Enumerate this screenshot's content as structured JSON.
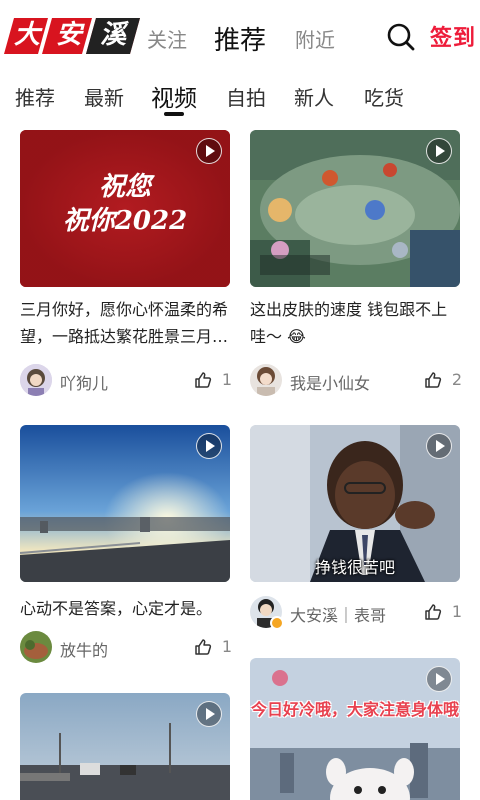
{
  "header": {
    "logo_chars": [
      "大",
      "安",
      "溪"
    ],
    "nav_follow": "关注",
    "nav_recommend": "推荐",
    "nav_nearby": "附近",
    "checkin_label": "签到"
  },
  "tabs": [
    "推荐",
    "最新",
    "视频",
    "自拍",
    "新人",
    "吃货"
  ],
  "active_tab": "视频",
  "cards": [
    {
      "thumb_text_line1": "祝您",
      "thumb_text_line2": "祝你2022",
      "caption": "三月你好，愿你心怀温柔的希望，一路抵达繁花胜景三月…",
      "author": "吖狗儿",
      "likes": "1"
    },
    {
      "caption": "这出皮肤的速度 钱包跟不上哇～",
      "emoji": "😂",
      "author": "我是小仙女",
      "likes": "2"
    },
    {
      "caption": "心动不是答案，心定才是。",
      "author": "放牛的",
      "likes": "1"
    },
    {
      "thumb_subtitle": "挣钱很苦吧",
      "author": "大安溪｜表哥",
      "likes": "1"
    },
    {
      "caption": ""
    },
    {
      "thumb_overlay": "今日好冷哦，大家注意身体哦"
    }
  ],
  "colors": {
    "brand_red": "#ee1c3a",
    "logo_bg": "#d8141f"
  }
}
